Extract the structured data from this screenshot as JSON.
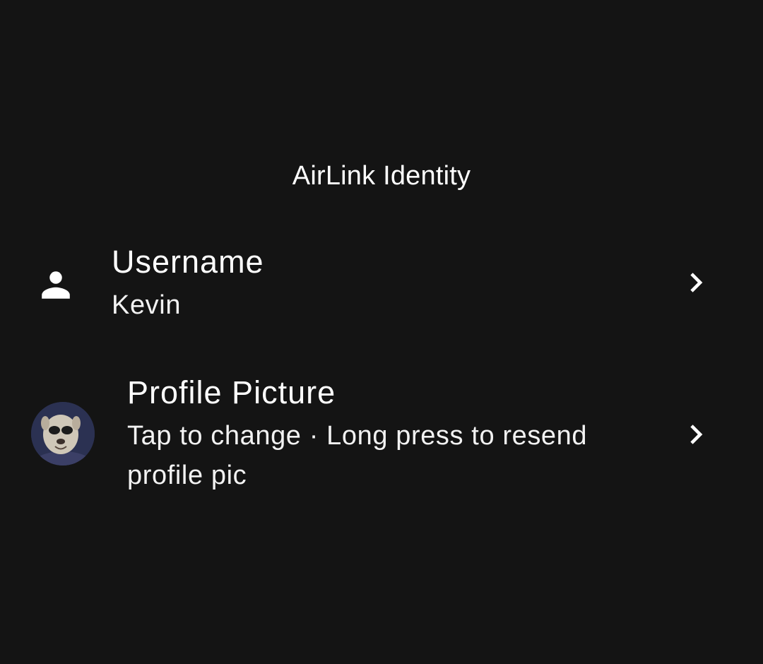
{
  "dialog": {
    "title": "AirLink Identity"
  },
  "rows": [
    {
      "icon": "person-icon",
      "primary": "Username",
      "secondary": "Kevin",
      "trailing_icon": "chevron-right-icon"
    },
    {
      "icon": "profile-avatar",
      "primary": "Profile Picture",
      "secondary": "Tap to change · Long press to resend profile pic",
      "trailing_icon": "chevron-right-icon"
    }
  ],
  "colors": {
    "background": "#141414",
    "text": "#ffffff"
  }
}
